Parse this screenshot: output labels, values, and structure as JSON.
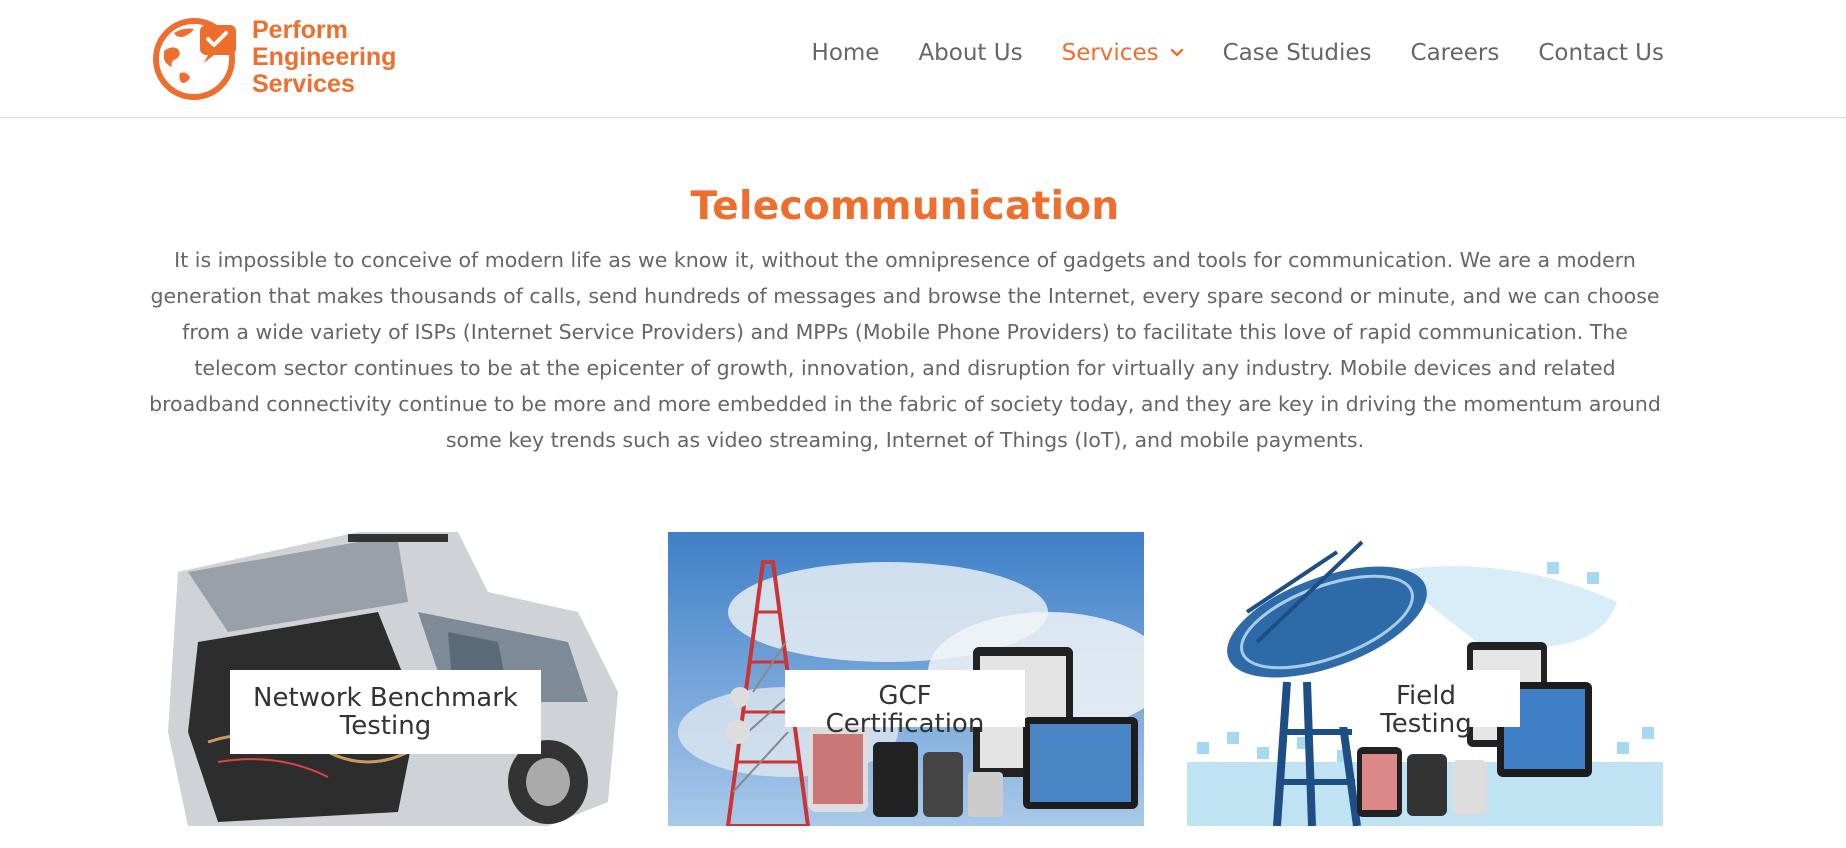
{
  "brand": {
    "name_line1": "Perform",
    "name_line2": "Engineering",
    "name_line3": "Services",
    "accent_color": "#ee6f2d"
  },
  "nav": {
    "items": [
      {
        "label": "Home",
        "active": false
      },
      {
        "label": "About Us",
        "active": false
      },
      {
        "label": "Services",
        "active": true,
        "has_dropdown": true
      },
      {
        "label": "Case Studies",
        "active": false
      },
      {
        "label": "Careers",
        "active": false
      },
      {
        "label": "Contact Us",
        "active": false
      }
    ]
  },
  "main": {
    "title": "Telecommunication",
    "intro": "It is impossible to conceive of modern life as we know it, without the omnipresence of gadgets and tools for communication. We are a modern generation that makes thousands of calls, send hundreds of messages and browse the Internet, every spare second or minute, and we can choose from a wide variety of ISPs (Internet Service Providers) and MPPs (Mobile Phone Providers) to facilitate this love of rapid communication. The telecom sector continues to be at the epicenter of growth, innovation, and disruption for virtually any industry. Mobile devices and related broadband connectivity continue to be more and more embedded in the fabric of society today, and they are key in driving the momentum around some key trends such as video streaming, Internet of Things (IoT), and mobile payments."
  },
  "cards": [
    {
      "label": "Network Benchmark Testing",
      "image": "car-with-test-equipment"
    },
    {
      "label": "GCF Certification",
      "image": "cell-tower-and-devices"
    },
    {
      "label": "Field Testing",
      "image": "satellite-dish-and-devices"
    }
  ]
}
